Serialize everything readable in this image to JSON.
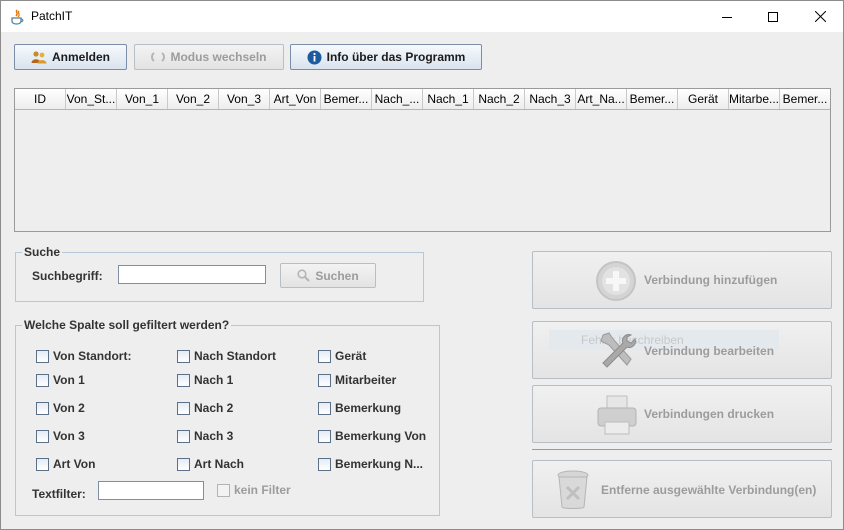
{
  "window": {
    "title": "PatchIT"
  },
  "toolbar": {
    "login_label": "Anmelden",
    "mode_label": "Modus wechseln",
    "info_label": "Info über das Programm"
  },
  "table": {
    "columns": [
      "ID",
      "Von_St...",
      "Von_1",
      "Von_2",
      "Von_3",
      "Art_Von",
      "Bemer...",
      "Nach_...",
      "Nach_1",
      "Nach_2",
      "Nach_3",
      "Art_Na...",
      "Bemer...",
      "Gerät",
      "Mitarbe...",
      "Bemer..."
    ]
  },
  "search": {
    "legend": "Suche",
    "term_label": "Suchbegriff:",
    "term_value": "",
    "search_button": "Suchen"
  },
  "filter": {
    "legend": "Welche Spalte soll gefiltert werden?",
    "checkboxes": [
      "Von Standort:",
      "Nach Standort",
      "Gerät",
      "Von 1",
      "Nach 1",
      "Mitarbeiter",
      "Von 2",
      "Nach 2",
      "Bemerkung",
      "Von 3",
      "Nach 3",
      "Bemerkung Von",
      "Art Von",
      "Art  Nach",
      "Bemerkung N..."
    ],
    "textfilter_label": "Textfilter:",
    "textfilter_value": "",
    "no_filter_label": "kein Filter"
  },
  "actions": {
    "add_label": "Verbindung hinzufügen",
    "edit_label": "Verbindung bearbeiten",
    "edit_overlay": "Fehler beschreiben",
    "print_label": "Verbindungen drucken",
    "remove_label": "Entferne ausgewählte Verbindung(en)"
  },
  "colors": {
    "accent": "#1e5aa0",
    "window_bg": "#eeeeee",
    "disabled_text": "#9c9c9c"
  }
}
